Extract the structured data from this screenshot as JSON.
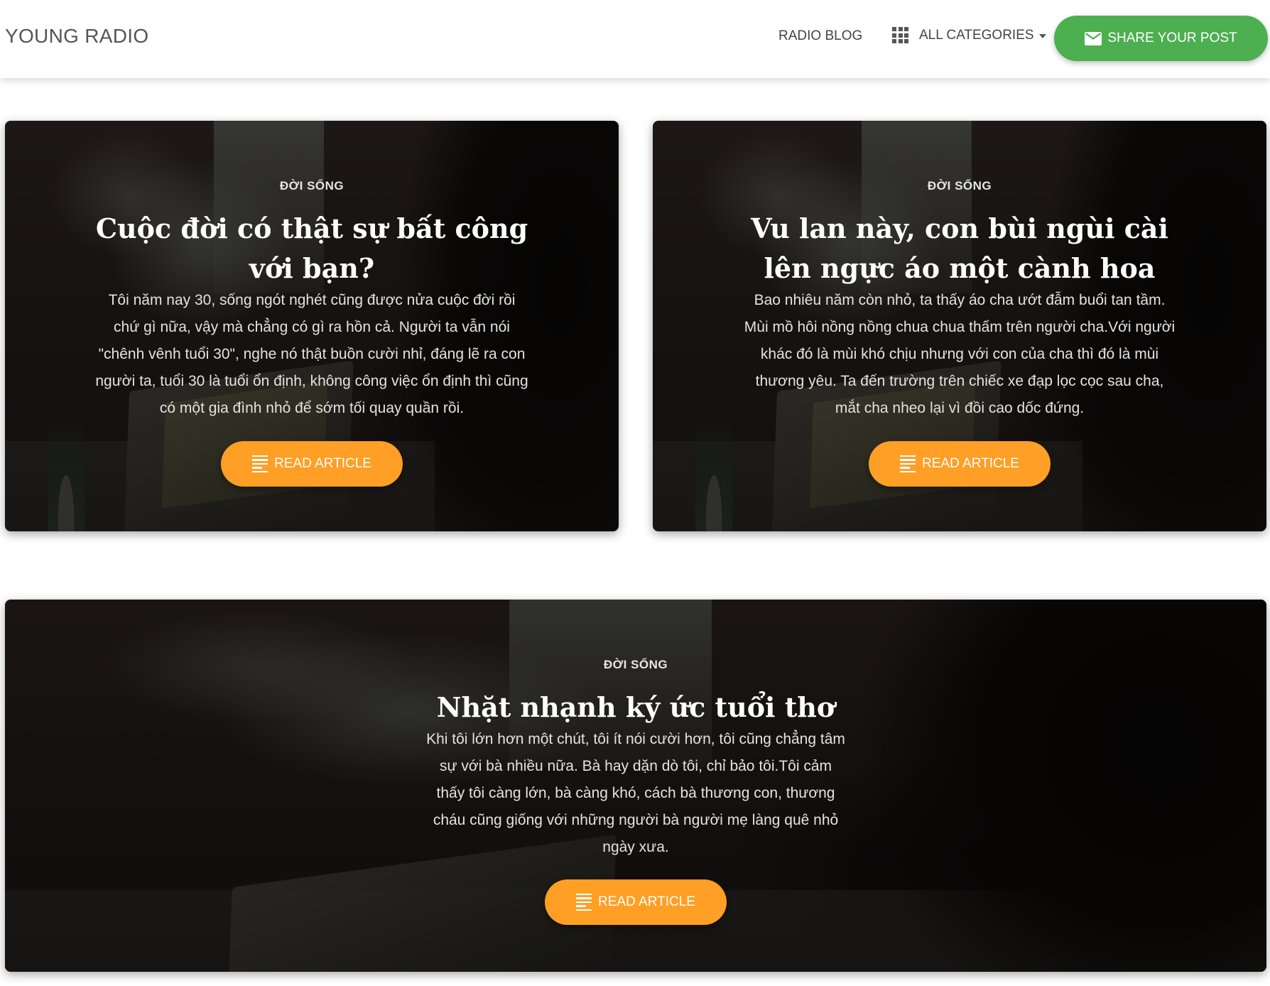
{
  "navbar": {
    "brand": "YOUNG RADIO",
    "blog_link": "RADIO BLOG",
    "categories_label": "ALL CATEGORIES",
    "share_label": "SHARE YOUR POST"
  },
  "colors": {
    "share_button": "#4caf50",
    "read_button": "#ff9f25"
  },
  "cards": [
    {
      "category": "ĐỜI SỐNG",
      "title": "Cuộc đời có thật sự bất công với bạn?",
      "excerpt": "Tôi năm nay 30, sống ngót nghét cũng được nửa cuộc đời rồi chứ gì nữa, vậy mà chẳng có gì ra hồn cả. Người ta vẫn nói \"chênh vênh tuổi 30\", nghe nó thật buồn cười nhỉ, đáng lẽ ra con người ta, tuổi 30 là tuổi ổn định, không công việc ổn định thì cũng có một gia đình nhỏ để sớm tối quay quần rồi.",
      "button": "READ ARTICLE"
    },
    {
      "category": "ĐỜI SỐNG",
      "title": "Vu lan này, con bùi ngùi cài lên ngực áo một cành hoa",
      "excerpt": "Bao nhiêu năm còn nhỏ, ta thấy áo cha ướt đẫm buổi tan tầm. Mùi mồ hôi nồng nồng chua chua thấm trên người cha.Với người khác đó là mùi khó chịu nhưng với con của cha thì đó là mùi thương yêu. Ta đến trường trên chiếc xe đạp lọc cọc sau cha, mắt cha nheo lại vì đồi cao dốc đứng.",
      "button": "READ ARTICLE"
    },
    {
      "category": "ĐỜI SỐNG",
      "title": "Nhặt nhạnh ký ức tuổi thơ",
      "excerpt": "Khi tôi lớn hơn một chút, tôi ít nói cười hơn, tôi cũng chẳng tâm sự với bà nhiều nữa. Bà hay dặn dò tôi, chỉ bảo tôi.Tôi cảm thấy tôi càng lớn, bà càng khó, cách bà thương con, thương cháu cũng giống với những người bà người mẹ làng quê nhỏ ngày xưa.",
      "button": "READ ARTICLE"
    }
  ]
}
